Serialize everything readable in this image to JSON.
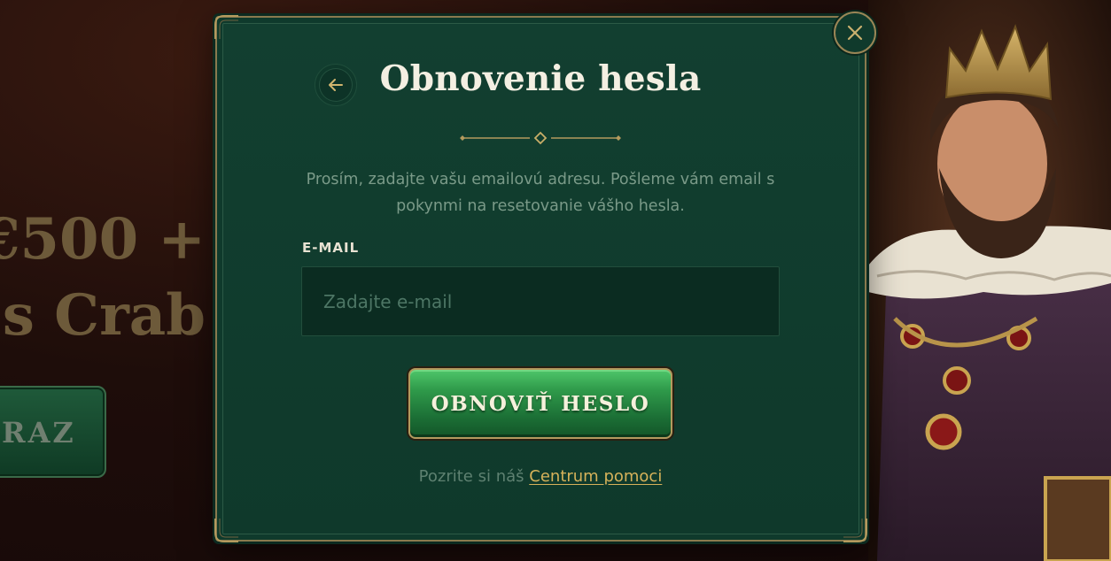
{
  "background": {
    "headline_line1": "€500 +",
    "headline_line2": "s Crab",
    "cta_label": "RAZ"
  },
  "modal": {
    "title": "Obnovenie hesla",
    "description": "Prosím, zadajte vašu emailovú adresu. Pošleme vám email s pokynmi na resetovanie vášho hesla.",
    "email_label": "E-MAIL",
    "email_placeholder": "Zadajte e-mail",
    "email_value": "",
    "submit_label": "OBNOVIŤ HESLO",
    "help_prefix": "Pozrite si náš",
    "help_link": "Centrum pomoci"
  },
  "icons": {
    "close": "close-icon",
    "back": "arrow-left-icon",
    "divider": "ornament-divider"
  },
  "colors": {
    "modal_bg": "#0f3a2c",
    "gold_accent": "#b39a5e",
    "button_green": "#2f9a4a",
    "link_gold": "#d6b25a",
    "text_muted": "#7a9a88"
  }
}
